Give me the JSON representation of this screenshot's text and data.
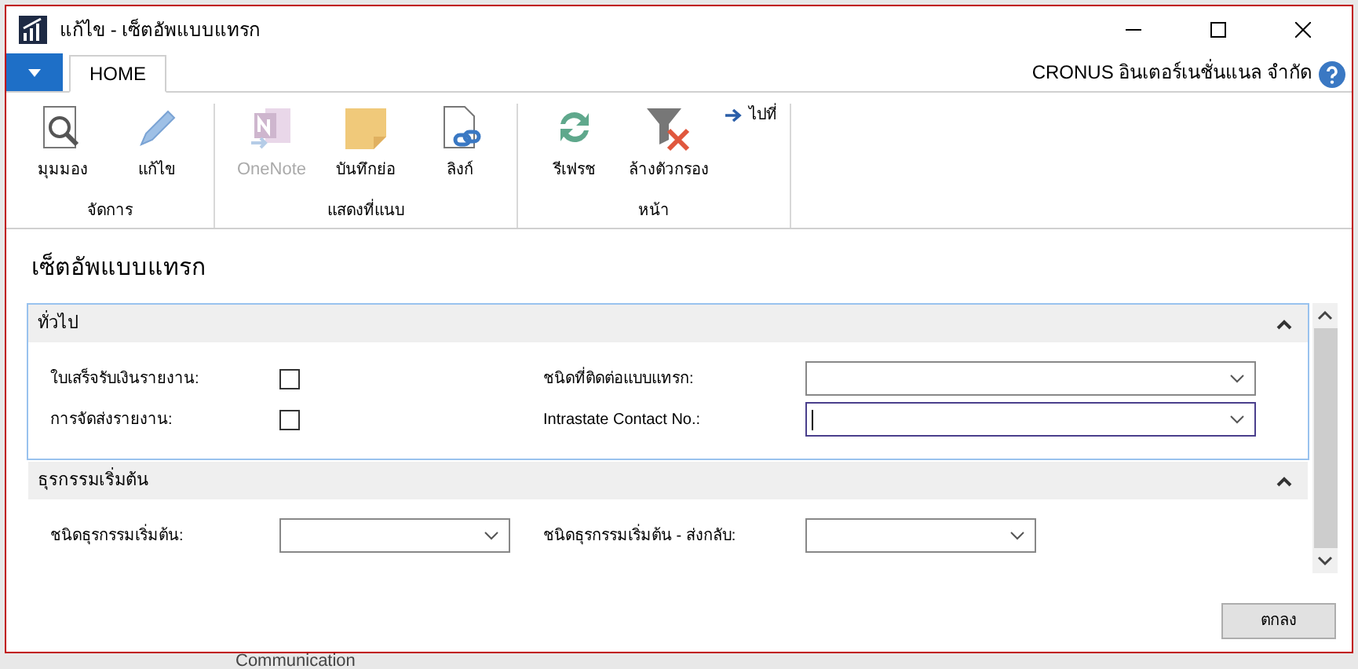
{
  "window": {
    "title": "แก้ไข - เซ็ตอัพแบบแทรก"
  },
  "ribbon": {
    "tabs": [
      {
        "label": "HOME",
        "selected": true
      }
    ],
    "company": "CRONUS อินเตอร์เนชั่นแนล จำกัด",
    "groups": [
      {
        "label": "จัดการ",
        "actions": [
          {
            "label": "มุมมอง",
            "kind": "view",
            "disabled": false
          },
          {
            "label": "แก้ไข",
            "kind": "edit",
            "disabled": false
          }
        ]
      },
      {
        "label": "แสดงที่แนบ",
        "actions": [
          {
            "label": "OneNote",
            "kind": "onenote",
            "disabled": true
          },
          {
            "label": "บันทึกย่อ",
            "kind": "note",
            "disabled": false
          },
          {
            "label": "ลิงก์",
            "kind": "link",
            "disabled": false
          }
        ]
      },
      {
        "label": "หน้า",
        "actions": [
          {
            "label": "รีเฟรช",
            "kind": "refresh",
            "disabled": false
          },
          {
            "label": "ล้างตัวกรอง",
            "kind": "clearfilter",
            "disabled": false
          }
        ],
        "small_action": "ไปที่"
      }
    ]
  },
  "page": {
    "title": "เซ็ตอัพแบบแทรก",
    "sections": [
      {
        "title": "ทั่วไป",
        "expanded": true,
        "focused": true,
        "columns": [
          [
            {
              "label": "ใบเสร็จรับเงินรายงาน:",
              "kind": "checkbox",
              "checked": false
            },
            {
              "label": "การจัดส่งรายงาน:",
              "kind": "checkbox",
              "checked": false
            }
          ],
          [
            {
              "label": "ชนิดที่ติดต่อแบบแทรก:",
              "kind": "dropdown",
              "focused": false
            },
            {
              "label": "Intrastate Contact No.:",
              "kind": "dropdown",
              "focused": true
            }
          ]
        ]
      },
      {
        "title": "ธุรกรรมเริ่มต้น",
        "expanded": true,
        "focused": false,
        "columns": [
          [
            {
              "label": "ชนิดธุรกรรมเริ่มต้น:",
              "kind": "dropdown",
              "focused": false
            }
          ],
          [
            {
              "label": "ชนิดธุรกรรมเริ่มต้น - ส่งกลับ:",
              "kind": "dropdown",
              "focused": false
            }
          ]
        ]
      }
    ]
  },
  "buttons": [
    {
      "label": "ตกลง"
    }
  ],
  "background_text": "Communication"
}
